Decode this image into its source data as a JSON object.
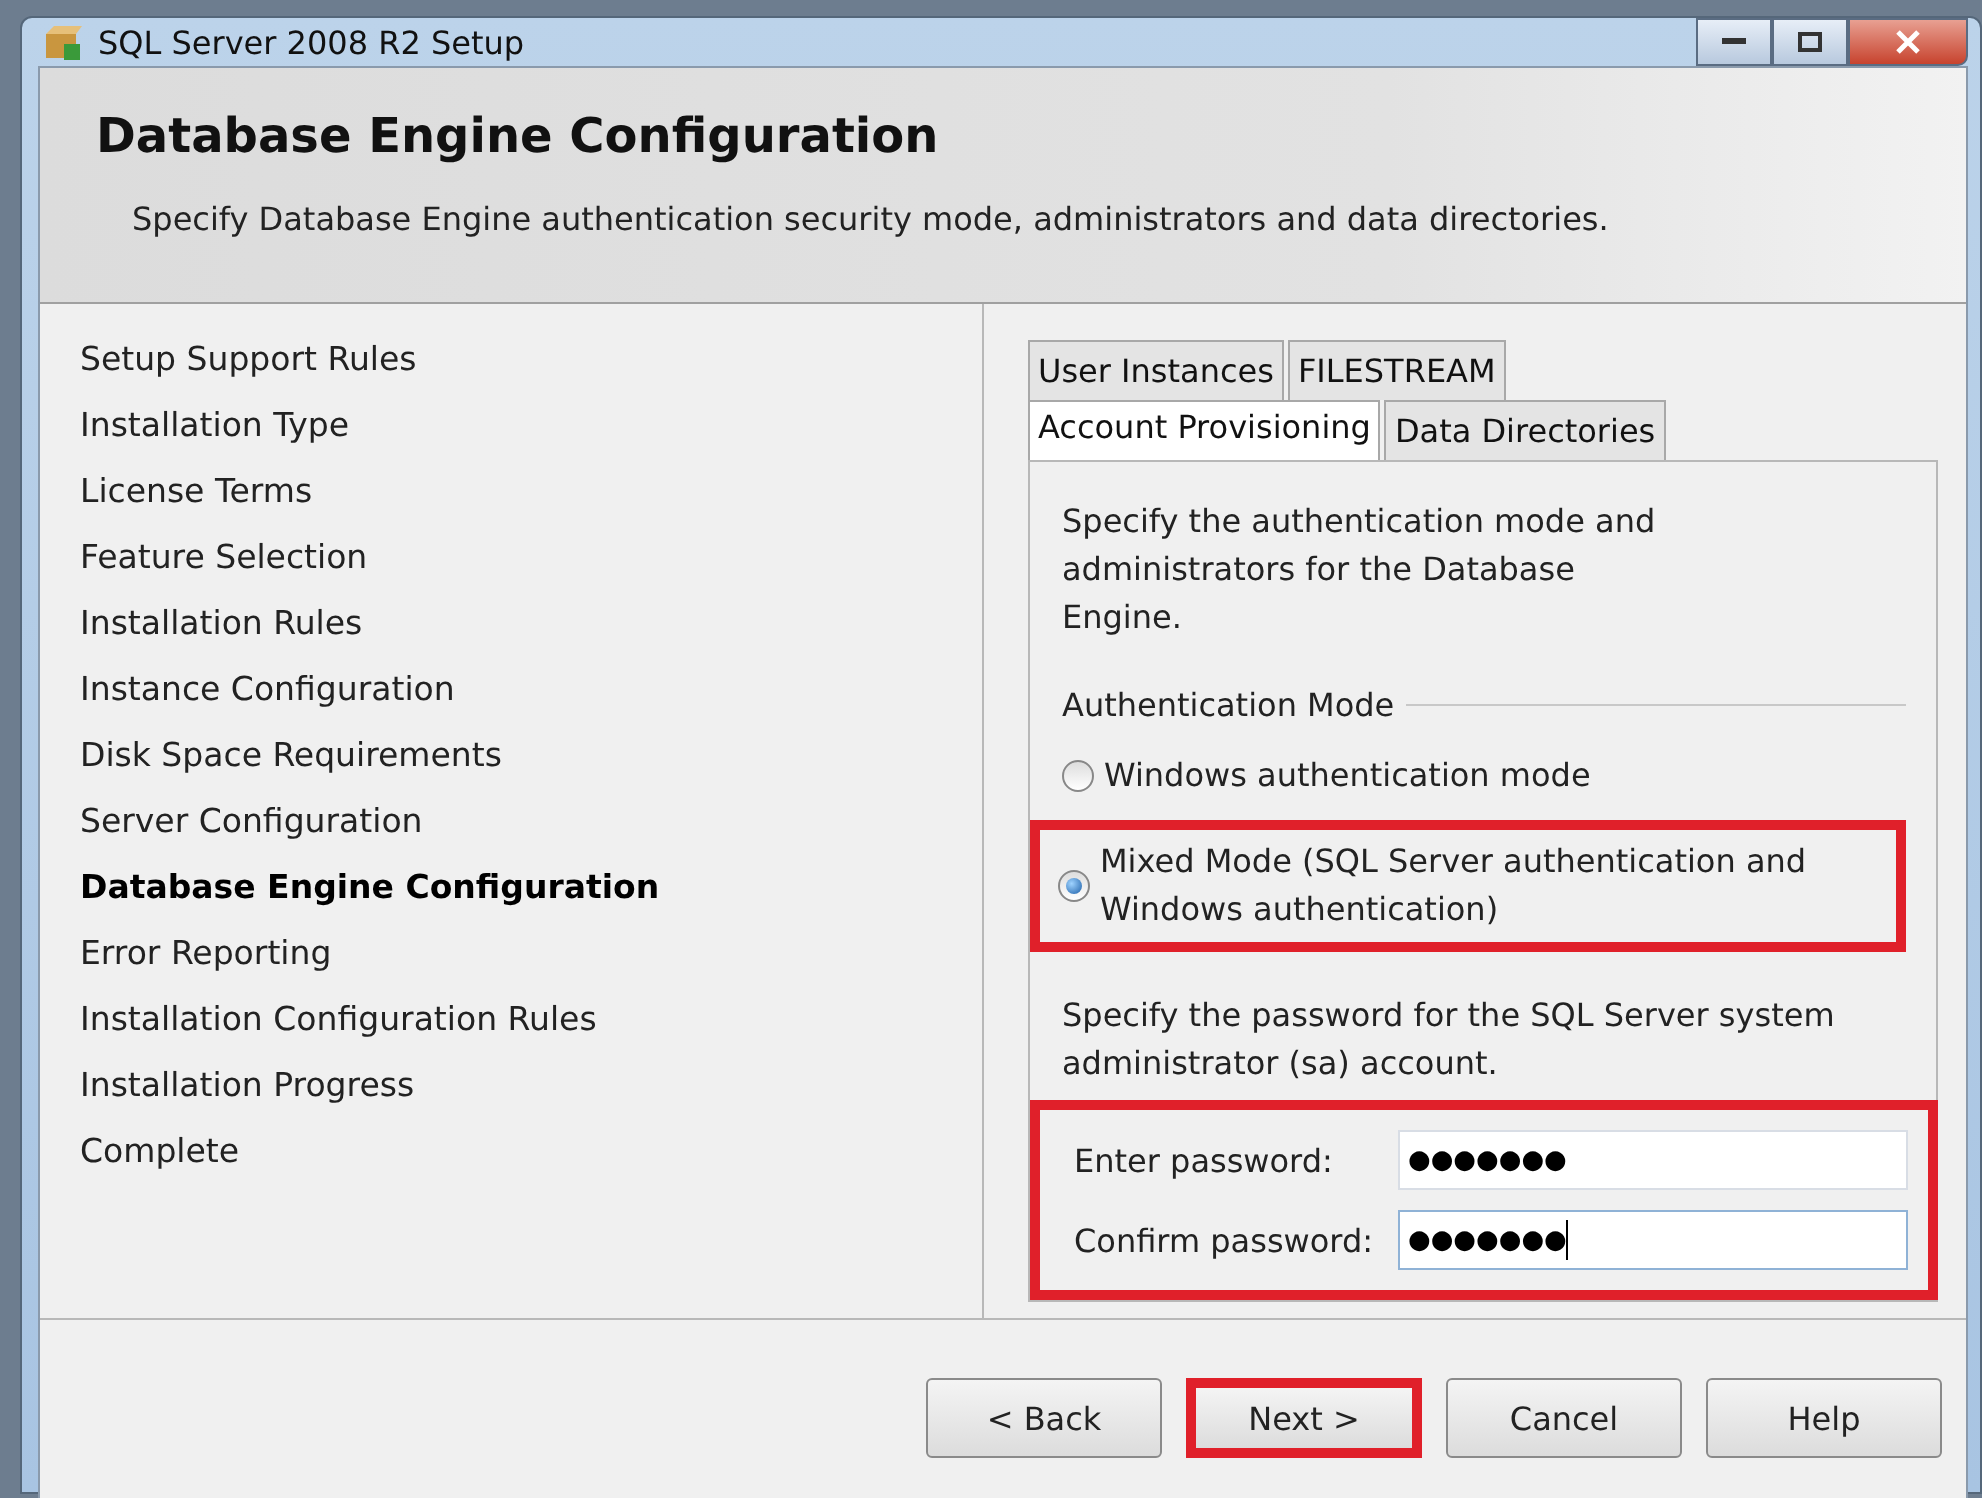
{
  "window": {
    "title": "SQL Server 2008 R2 Setup"
  },
  "header": {
    "title": "Database Engine Configuration",
    "subtitle": "Specify Database Engine authentication security mode, administrators and data directories."
  },
  "sidebar": {
    "items": [
      {
        "label": "Setup Support Rules",
        "selected": false
      },
      {
        "label": "Installation Type",
        "selected": false
      },
      {
        "label": "License Terms",
        "selected": false
      },
      {
        "label": "Feature Selection",
        "selected": false
      },
      {
        "label": "Installation Rules",
        "selected": false
      },
      {
        "label": "Instance Configuration",
        "selected": false
      },
      {
        "label": "Disk Space Requirements",
        "selected": false
      },
      {
        "label": "Server Configuration",
        "selected": false
      },
      {
        "label": "Database Engine Configuration",
        "selected": true
      },
      {
        "label": "Error Reporting",
        "selected": false
      },
      {
        "label": "Installation Configuration Rules",
        "selected": false
      },
      {
        "label": "Installation Progress",
        "selected": false
      },
      {
        "label": "Complete",
        "selected": false
      }
    ]
  },
  "tabs": [
    [
      {
        "label": "User Instances",
        "selected": false
      },
      {
        "label": "FILESTREAM",
        "selected": false
      }
    ],
    [
      {
        "label": "Account Provisioning",
        "selected": true
      },
      {
        "label": "Data Directories",
        "selected": false
      }
    ]
  ],
  "panel": {
    "intro": "Specify the authentication mode and administrators for the Database Engine.",
    "group_title": "Authentication Mode",
    "modes": [
      {
        "label": "Windows authentication mode",
        "selected": false,
        "highlighted": false
      },
      {
        "label": "Mixed Mode (SQL Server authentication and Windows authentication)",
        "selected": true,
        "highlighted": true
      }
    ],
    "password_note": "Specify the password for the SQL Server system administrator (sa) account.",
    "password_group_highlighted": true,
    "fields": [
      {
        "label": "Enter password:",
        "value": "●●●●●●●",
        "focused": false
      },
      {
        "label": "Confirm password:",
        "value": "●●●●●●●",
        "focused": true
      }
    ]
  },
  "buttons": [
    {
      "label": "< Back",
      "highlighted": false
    },
    {
      "label": "Next >",
      "highlighted": true
    },
    {
      "label": "Cancel",
      "highlighted": false
    },
    {
      "label": "Help",
      "highlighted": false
    }
  ]
}
